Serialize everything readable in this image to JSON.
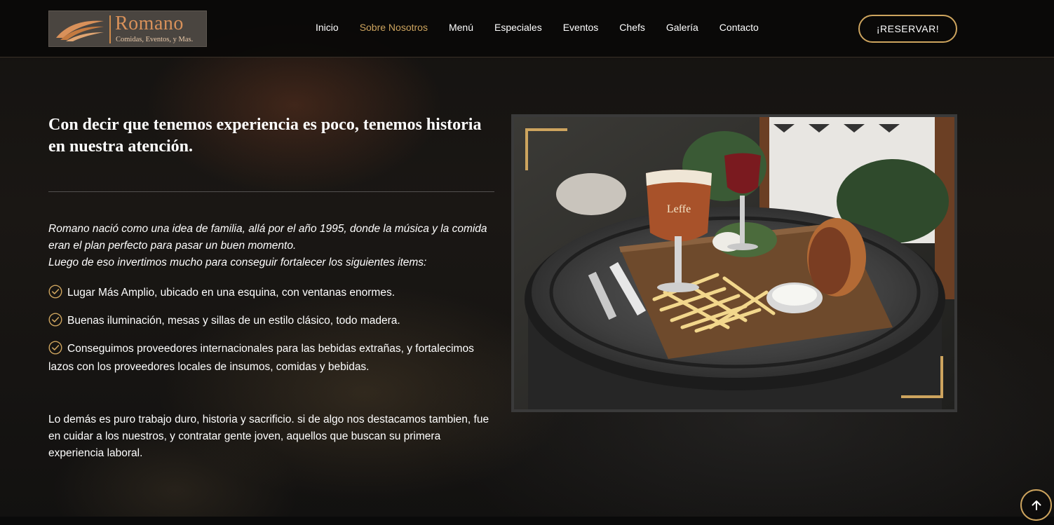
{
  "brand": {
    "name": "Romano",
    "tagline": "Comidas, Eventos, y Mas.",
    "accent_color": "#cda45e"
  },
  "nav": {
    "items": [
      {
        "label": "Inicio",
        "active": false
      },
      {
        "label": "Sobre Nosotros",
        "active": true
      },
      {
        "label": "Menú",
        "active": false
      },
      {
        "label": "Especiales",
        "active": false
      },
      {
        "label": "Eventos",
        "active": false
      },
      {
        "label": "Chefs",
        "active": false
      },
      {
        "label": "Galería",
        "active": false
      },
      {
        "label": "Contacto",
        "active": false
      }
    ],
    "cta_label": "¡RESERVAR!"
  },
  "about": {
    "headline": "Con decir que tenemos experiencia es poco, tenemos historia en nuestra atención.",
    "intro_line1": "Romano nació como una idea de familia, allá por el año 1995, donde la música y la comida eran el plan perfecto para pasar un buen momento.",
    "intro_line2": "Luego de eso invertimos mucho para conseguir fortalecer los siguientes items:",
    "features": [
      "Lugar Más Amplio, ubicado en una esquina, con ventanas enormes.",
      "Buenas iluminación, mesas y sillas de un estilo clásico, todo madera.",
      "Conseguimos proveedores internacionales para las bebidas extrañas, y fortalecimos lazos con los proveedores locales de insumos, comidas y bebidas."
    ],
    "closing": "Lo demás es puro trabajo duro, historia y sacrificio. si de algo nos destacamos tambien, fue en cuidar a los nuestros, y contratar gente joven, aquellos que buscan su primera experiencia laboral.",
    "photo_glass_label": "Leffe"
  },
  "icons": {
    "check": "check-circle-icon",
    "back_to_top": "arrow-up-icon"
  }
}
